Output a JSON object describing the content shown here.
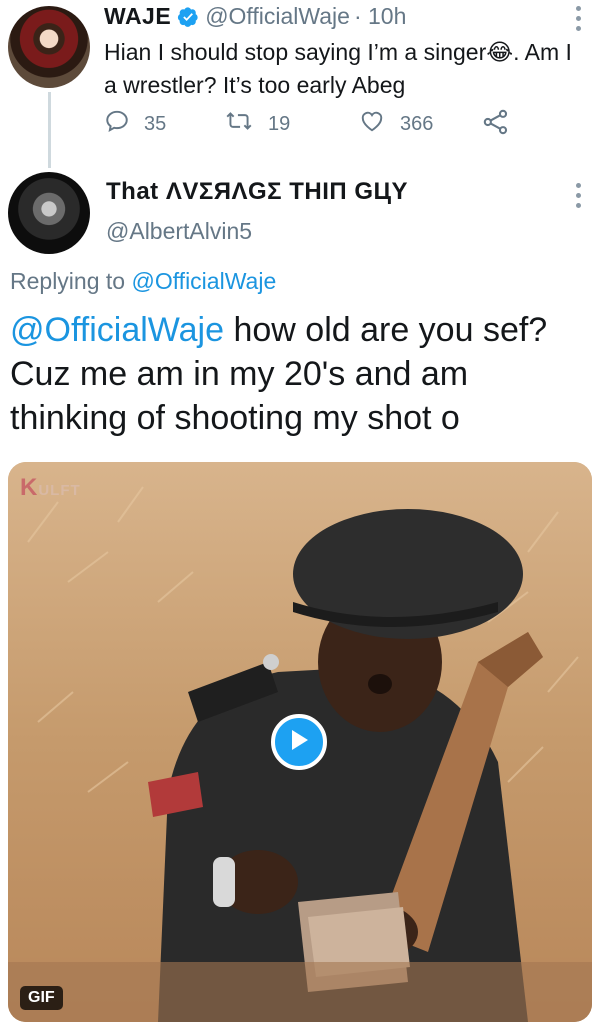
{
  "parent_tweet": {
    "name": "WAJE",
    "handle": "@OfficialWaje",
    "time": "· 10h",
    "text": "Hian I should stop saying I’m a singer😂. Am I a wrestler? It’s too early Abeg",
    "replies": "35",
    "retweets": "19",
    "likes": "366"
  },
  "reply_tweet": {
    "name": "That ΛVΣЯΛGΣ THIП GЦY",
    "handle": "@AlbertAlvin5",
    "replying_prefix": "Replying to",
    "replying_to": "@OfficialWaje",
    "mention": "@OfficialWaje",
    "text": " how old are you sef? Cuz me am in my 20's and am thinking of shooting my shot o"
  },
  "media": {
    "watermark_initial": "K",
    "watermark_rest": "ULFT",
    "badge": "GIF"
  },
  "colors": {
    "accent": "#1da1f2",
    "link": "#1b95e0",
    "secondary_text": "#657786",
    "thread_line": "#cfd9de"
  },
  "icons": [
    "verified-badge-icon",
    "more-options-icon",
    "reply-icon",
    "retweet-icon",
    "like-icon",
    "share-icon",
    "play-icon"
  ]
}
